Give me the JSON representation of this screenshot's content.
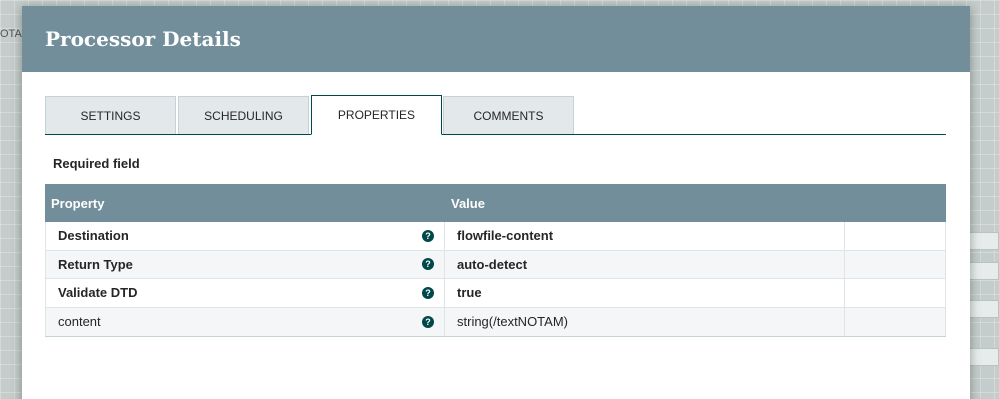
{
  "background": {
    "canvas_label": "OTAM"
  },
  "dialog": {
    "title": "Processor Details",
    "header_color": "#728e9b",
    "tabs": [
      {
        "label": "SETTINGS",
        "active": false
      },
      {
        "label": "SCHEDULING",
        "active": false
      },
      {
        "label": "PROPERTIES",
        "active": true
      },
      {
        "label": "COMMENTS",
        "active": false
      }
    ],
    "required_field_label": "Required field",
    "properties_table": {
      "columns": [
        "Property",
        "Value"
      ],
      "rows": [
        {
          "property": "Destination",
          "value": "flowfile-content",
          "required": true,
          "icon": "help-icon"
        },
        {
          "property": "Return Type",
          "value": "auto-detect",
          "required": true,
          "icon": "help-icon"
        },
        {
          "property": "Validate DTD",
          "value": "true",
          "required": true,
          "icon": "help-icon"
        },
        {
          "property": "content",
          "value": "string(/textNOTAM)",
          "required": false,
          "icon": "help-icon"
        }
      ]
    }
  }
}
